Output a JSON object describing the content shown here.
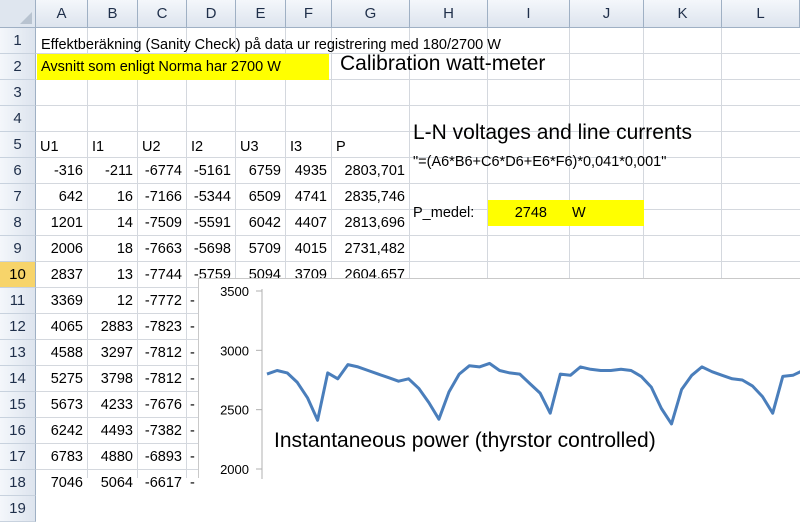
{
  "columns": [
    "A",
    "B",
    "C",
    "D",
    "E",
    "F",
    "G",
    "H",
    "I",
    "J",
    "K",
    "L"
  ],
  "rows": [
    "1",
    "2",
    "3",
    "4",
    "5",
    "6",
    "7",
    "8",
    "9",
    "10",
    "11",
    "12",
    "13",
    "14",
    "15",
    "16",
    "17",
    "18",
    "19"
  ],
  "title_cell": "Effektberäkning (Sanity Check) på data ur registrering med 180/2700 W",
  "row2_cell": "Avsnitt som enligt Norma har 2700 W",
  "calibration_label": "Calibration watt-meter",
  "header": [
    "U1",
    "I1",
    "U2",
    "I2",
    "U3",
    "I3",
    "P"
  ],
  "ln_label": "L-N voltages and line currents",
  "formula": "\"=(A6*B6+C6*D6+E6*F6)*0,041*0,001\"",
  "pmedel_label": "P_medel:",
  "pmedel_value": "2748",
  "pmedel_unit": "W",
  "data_rows": [
    [
      "-316",
      "-211",
      "-6774",
      "-5161",
      "6759",
      "4935",
      "2803,701"
    ],
    [
      "642",
      "16",
      "-7166",
      "-5344",
      "6509",
      "4741",
      "2835,746"
    ],
    [
      "1201",
      "14",
      "-7509",
      "-5591",
      "6042",
      "4407",
      "2813,696"
    ],
    [
      "2006",
      "18",
      "-7663",
      "-5698",
      "5709",
      "4015",
      "2731,482"
    ],
    [
      "2837",
      "13",
      "-7744",
      "-5759",
      "5094",
      "3709",
      "2604,657"
    ],
    [
      "3369",
      "12",
      "-7772",
      "-",
      "",
      "",
      ""
    ],
    [
      "4065",
      "2883",
      "-7823",
      "-",
      "",
      "",
      ""
    ],
    [
      "4588",
      "3297",
      "-7812",
      "-",
      "",
      "",
      ""
    ],
    [
      "5275",
      "3798",
      "-7812",
      "-",
      "",
      "",
      ""
    ],
    [
      "5673",
      "4233",
      "-7676",
      "-",
      "",
      "",
      ""
    ],
    [
      "6242",
      "4493",
      "-7382",
      "-",
      "",
      "",
      ""
    ],
    [
      "6783",
      "4880",
      "-6893",
      "-",
      "",
      "",
      ""
    ],
    [
      "7046",
      "5064",
      "-6617",
      "-",
      "",
      "",
      ""
    ]
  ],
  "chart_data": {
    "type": "line",
    "title": "Instantaneous power (thyrstor controlled)",
    "xlabel": "",
    "ylabel": "",
    "y_ticks": [
      "3500",
      "3000",
      "2500",
      "2000"
    ],
    "ylim": [
      2000,
      3500
    ],
    "grid": false,
    "series": [
      {
        "color": "#4a7ebb",
        "values": [
          2800,
          2830,
          2810,
          2730,
          2600,
          2410,
          2810,
          2760,
          2880,
          2860,
          2830,
          2800,
          2770,
          2740,
          2760,
          2680,
          2560,
          2420,
          2650,
          2800,
          2870,
          2860,
          2890,
          2830,
          2810,
          2800,
          2720,
          2640,
          2470,
          2800,
          2790,
          2860,
          2840,
          2830,
          2830,
          2840,
          2830,
          2780,
          2690,
          2510,
          2380,
          2670,
          2790,
          2860,
          2820,
          2790,
          2760,
          2750,
          2700,
          2610,
          2470,
          2780,
          2790,
          2830
        ]
      }
    ]
  }
}
